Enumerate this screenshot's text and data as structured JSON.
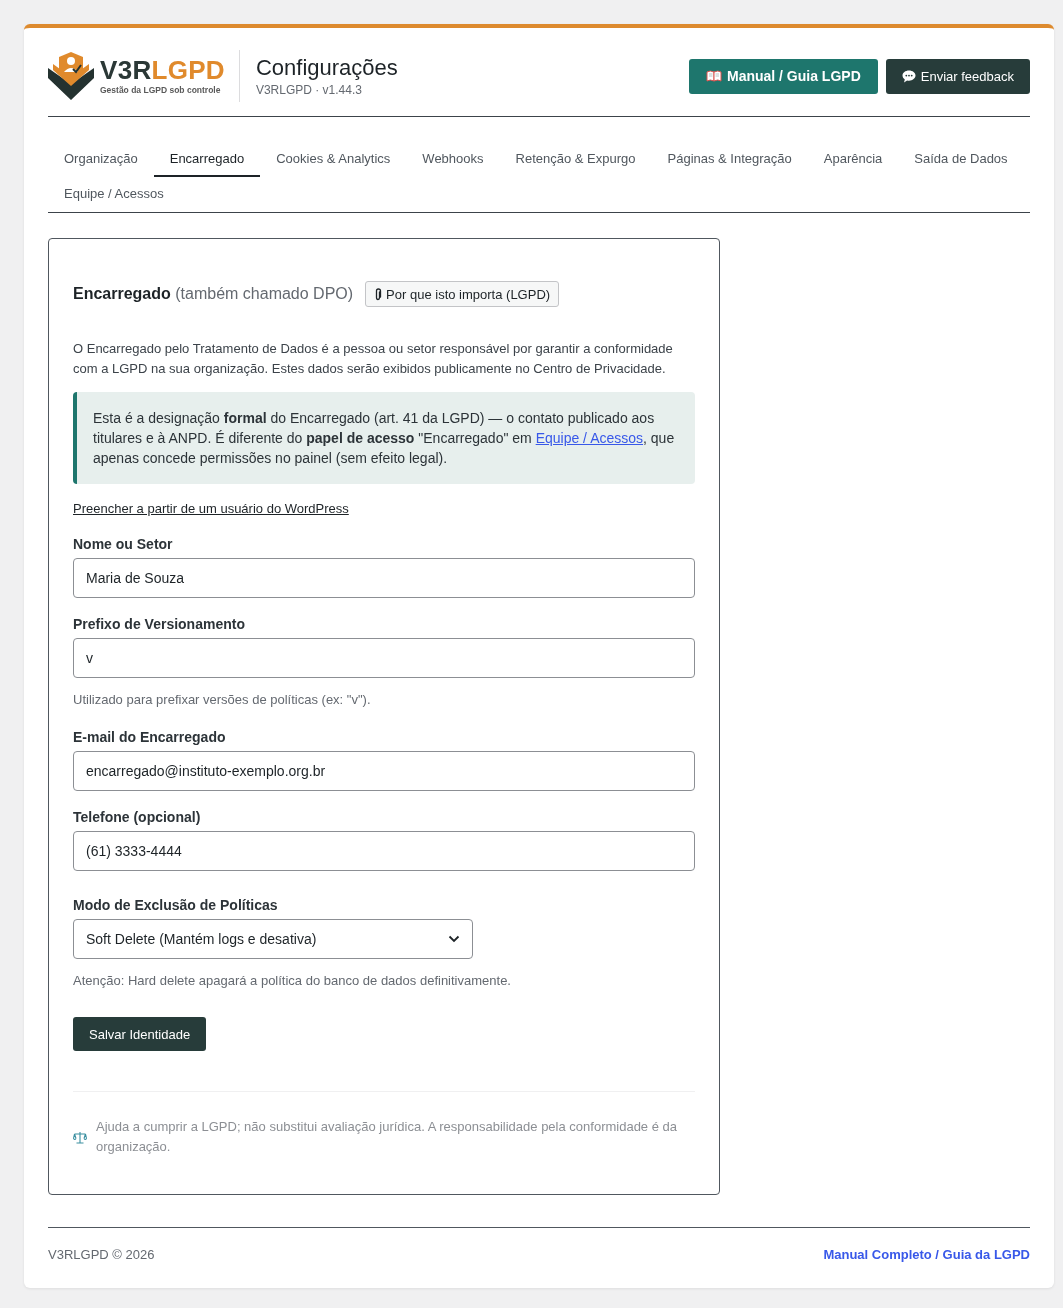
{
  "header": {
    "logo": {
      "wordmark": [
        "V3R",
        "LGPD"
      ],
      "tagline": "Gestão da LGPD sob controle"
    },
    "title": "Configurações",
    "subtitle": "V3RLGPD · v1.44.3",
    "buttons": [
      {
        "label": "Manual / Guia LGPD",
        "kind": "primary"
      },
      {
        "label": "Enviar feedback",
        "kind": "secondary"
      }
    ]
  },
  "tabs": [
    {
      "label": "Organização",
      "selected": false
    },
    {
      "label": "Encarregado",
      "selected": true
    },
    {
      "label": "Cookies & Analytics",
      "selected": false
    },
    {
      "label": "Webhooks",
      "selected": false
    },
    {
      "label": "Retenção & Expurgo",
      "selected": false
    },
    {
      "label": "Páginas & Integração",
      "selected": false
    },
    {
      "label": "Aparência",
      "selected": false
    },
    {
      "label": "Saída de Dados",
      "selected": false
    },
    {
      "label": "Equipe / Acessos",
      "selected": false
    }
  ],
  "section": {
    "title": "Encarregado",
    "title_note": "(também chamado DPO)",
    "help_button": "Por que isto importa (LGPD)",
    "intro": "O Encarregado pelo Tratamento de Dados é a pessoa ou setor responsável por garantir a conformidade com a LGPD na sua organização. Estes dados serão exibidos publicamente no Centro de Privacidade.",
    "notice": [
      {
        "kind": "text",
        "text": "Esta é a designação **formal** do Encarregado (art. 41 da LGPD) — o contato publicado aos titulares e à ANPD. É diferente do **papel de acesso** \"Encarregado\" em "
      },
      {
        "kind": "link",
        "text": "Equipe / Acessos"
      },
      {
        "kind": "text",
        "text": ", que apenas concede permissões no painel (sem efeito legal)."
      }
    ],
    "fill_link": "Preencher a partir de um usuário do WordPress",
    "fields": [
      {
        "kind": "text",
        "label": "Nome ou Setor",
        "value": "Maria de Souza"
      },
      {
        "kind": "text",
        "label": "Prefixo de Versionamento",
        "value": "v",
        "description": "Utilizado para prefixar versões de políticas (ex: \"v\")."
      },
      {
        "kind": "text",
        "label": "E-mail do Encarregado",
        "value": "encarregado@instituto-exemplo.org.br"
      },
      {
        "kind": "text",
        "label": "Telefone (opcional)",
        "value": "(61) 3333-4444"
      },
      {
        "kind": "select",
        "label": "Modo de Exclusão de Políticas",
        "value": "Soft Delete (Mantém logs e desativa)",
        "description": "Atenção: Hard delete apagará a política do banco de dados definitivamente."
      }
    ],
    "save_button": "Salvar Identidade",
    "disclaimer": "Ajuda a cumprir a LGPD; não substitui avaliação jurídica. A responsabilidade pela conformidade é da organização."
  },
  "footer": {
    "copyright": "V3RLGPD © 2026",
    "link": "Manual Completo / Guia da LGPD"
  }
}
